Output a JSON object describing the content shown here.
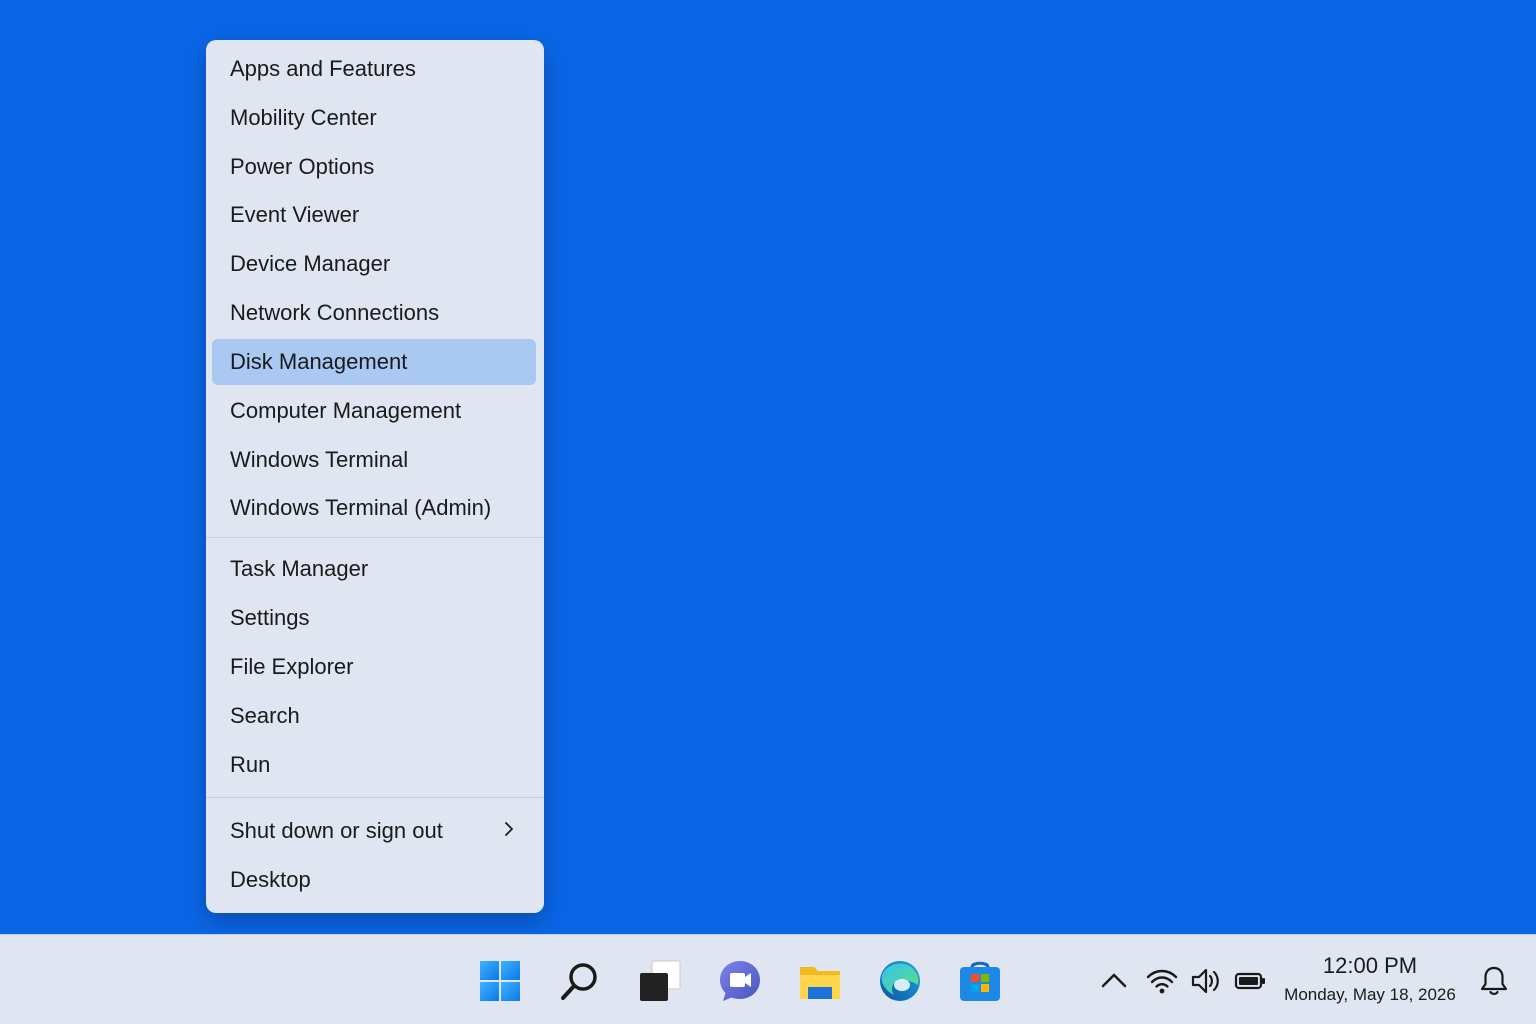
{
  "menu": {
    "items": [
      {
        "label": "Apps and Features"
      },
      {
        "label": "Mobility Center"
      },
      {
        "label": "Power Options"
      },
      {
        "label": "Event Viewer"
      },
      {
        "label": "Device Manager"
      },
      {
        "label": "Network Connections"
      },
      {
        "label": "Disk Management",
        "highlighted": true
      },
      {
        "label": "Computer Management"
      },
      {
        "label": "Windows Terminal"
      },
      {
        "label": "Windows Terminal (Admin)"
      },
      {
        "label": "Task Manager"
      },
      {
        "label": "Settings"
      },
      {
        "label": "File Explorer"
      },
      {
        "label": "Search"
      },
      {
        "label": "Run"
      },
      {
        "label": "Shut down or sign out",
        "submenu_icon": "chevron-right-icon"
      },
      {
        "label": "Desktop"
      }
    ],
    "highlight_color": "#a9c8f2"
  },
  "taskbar": {
    "icons": [
      "windows-start-icon",
      "search-icon",
      "task-view-icon",
      "teams-chat-icon",
      "file-explorer-icon",
      "edge-icon",
      "store-icon"
    ],
    "tray_icons": [
      "chevron-up-icon",
      "wifi-icon",
      "volume-icon",
      "battery-icon",
      "bell-icon"
    ],
    "clock": {
      "time": "12:00 PM",
      "date": "Monday, May 18, 2026"
    }
  },
  "colors": {
    "desktop": "#0a66e6",
    "menu_bg": "#dfe6f2",
    "taskbar_bg": "#dfe6f1"
  }
}
